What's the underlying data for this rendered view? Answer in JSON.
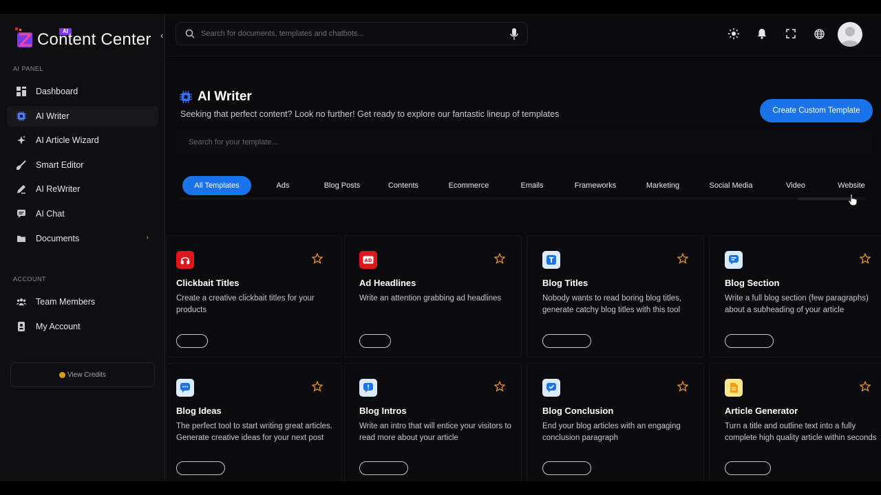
{
  "sidebar": {
    "logo_badge": "AI",
    "logo_text": "Content Center",
    "section_panel": "AI PANEL",
    "panel_items": [
      {
        "label": "Dashboard",
        "icon": "dashboard-icon"
      },
      {
        "label": "AI Writer",
        "icon": "chip-icon",
        "active": true
      },
      {
        "label": "AI Article Wizard",
        "icon": "sparkle-icon"
      },
      {
        "label": "Smart Editor",
        "icon": "brush-icon"
      },
      {
        "label": "AI ReWriter",
        "icon": "pen-icon"
      },
      {
        "label": "AI Chat",
        "icon": "chat-icon"
      },
      {
        "label": "Documents",
        "icon": "folder-icon",
        "has_arrow": true
      }
    ],
    "section_account": "ACCOUNT",
    "account_items": [
      {
        "label": "Team Members",
        "icon": "team-icon"
      },
      {
        "label": "My Account",
        "icon": "account-icon"
      }
    ],
    "credits_label": "View Credits"
  },
  "topbar": {
    "search_placeholder": "Search for documents, templates and chatbots..."
  },
  "main": {
    "title": "AI Writer",
    "subtitle": "Seeking that perfect content? Look no further! Get ready to explore our fantastic lineup of templates",
    "create_button": "Create Custom Template",
    "template_search_placeholder": "Search for your template...",
    "filters": [
      "All Templates",
      "Ads",
      "Blog Posts",
      "Contents",
      "Ecommerce",
      "Emails",
      "Frameworks",
      "Marketing",
      "Social Media",
      "Video",
      "Website"
    ],
    "cards": [
      {
        "title": "Clickbait Titles",
        "desc": "Create a creative clickbait titles for your products",
        "icon_color": "#e0161e",
        "icon": "headphones-icon"
      },
      {
        "title": "Ad Headlines",
        "desc": "Write an attention grabbing ad headlines",
        "icon_color": "#e0161e",
        "icon": "ad-icon"
      },
      {
        "title": "Blog Titles",
        "desc": "Nobody wants to read boring blog titles, generate catchy blog titles with this tool",
        "icon_color": "#dbeafe",
        "icon": "text-icon"
      },
      {
        "title": "Blog Section",
        "desc": "Write a full blog section (few paragraphs) about a subheading of your article",
        "icon_color": "#dbeafe",
        "icon": "message-icon"
      },
      {
        "title": "Blog Ideas",
        "desc": "The perfect tool to start writing great articles. Generate creative ideas for your next post",
        "icon_color": "#dbeafe",
        "icon": "chat-icon"
      },
      {
        "title": "Blog Intros",
        "desc": "Write an intro that will entice your visitors to read more about your article",
        "icon_color": "#dbeafe",
        "icon": "alert-icon"
      },
      {
        "title": "Blog Conclusion",
        "desc": "End your blog articles with an engaging conclusion paragraph",
        "icon_color": "#dbeafe",
        "icon": "check-icon"
      },
      {
        "title": "Article Generator",
        "desc": "Turn a title and outline text into a fully complete high quality article within seconds",
        "icon_color": "#fde68a",
        "icon": "document-icon"
      }
    ]
  },
  "colors": {
    "accent": "#1a73e8",
    "star": "#e8952b",
    "credits_dot": "#d89b1d"
  }
}
